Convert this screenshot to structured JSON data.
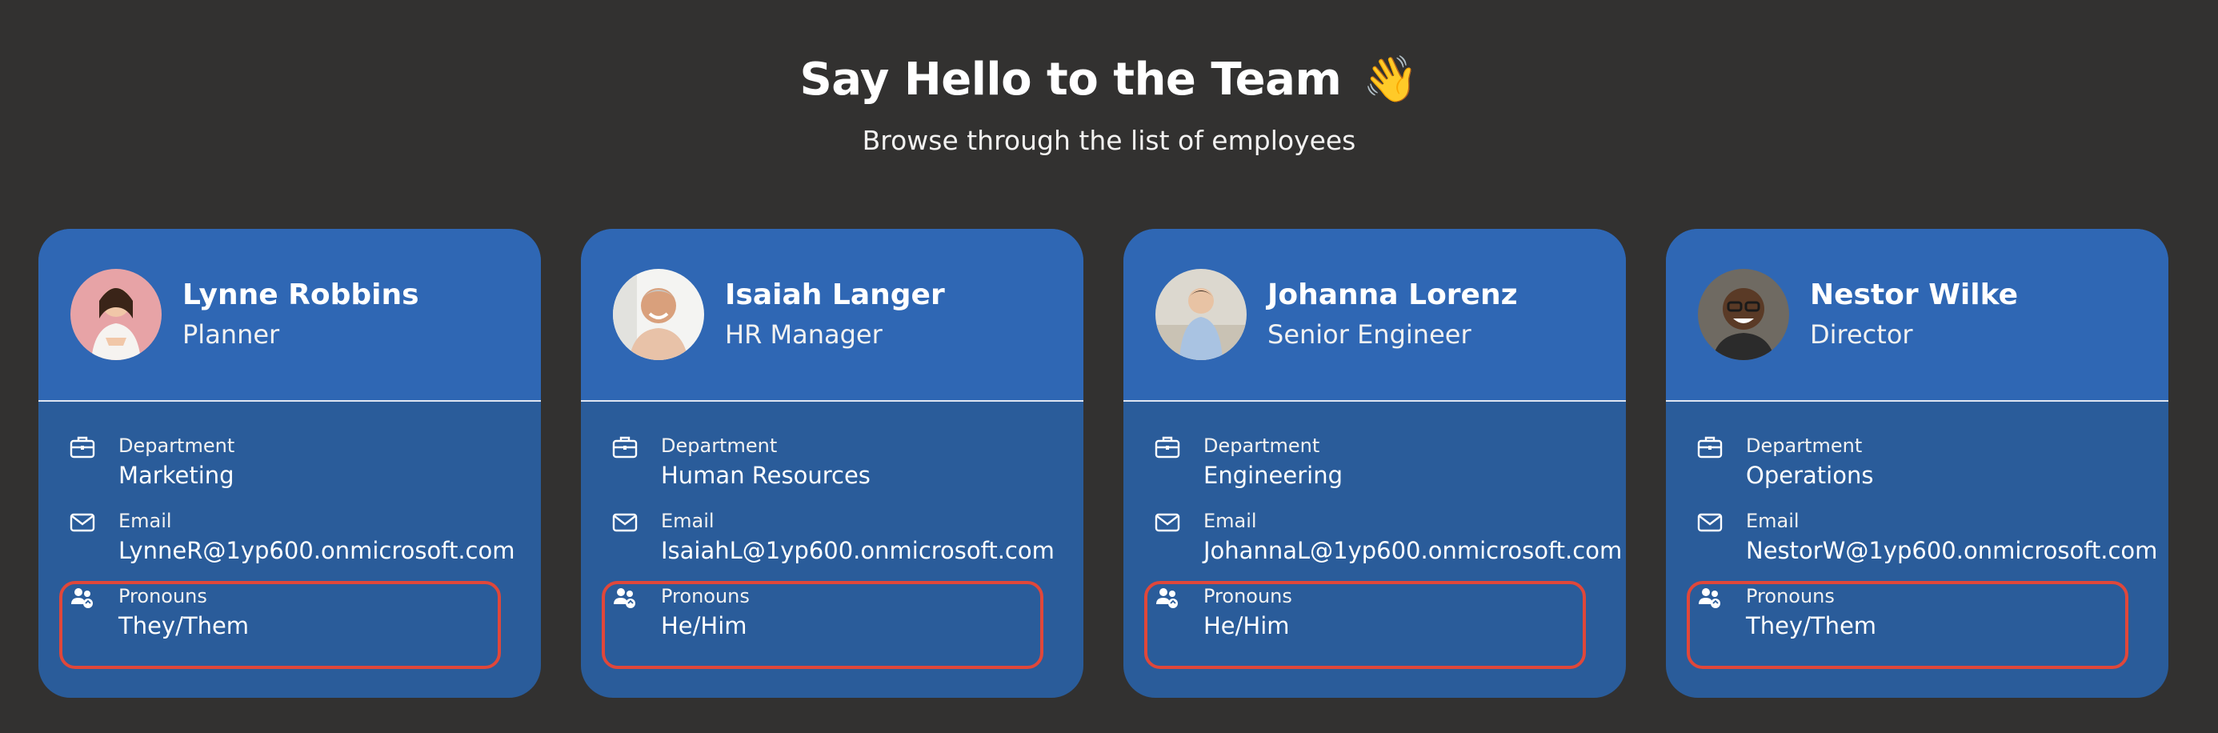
{
  "header": {
    "title": "Say Hello to the Team",
    "wave": "👋",
    "subtitle": "Browse through the list of employees"
  },
  "labels": {
    "department": "Department",
    "email": "Email",
    "pronouns": "Pronouns"
  },
  "icons": {
    "department": "briefcase-icon",
    "email": "mail-icon",
    "pronouns": "people-icon"
  },
  "colors": {
    "background": "#323130",
    "card_top": "#2f67b4",
    "card_body": "#2a5c9a",
    "highlight": "#e0473a"
  },
  "employees": [
    {
      "name": "Lynne Robbins",
      "title": "Planner",
      "department": "Marketing",
      "email": "LynneR@1yp600.onmicrosoft.com",
      "pronouns": "They/Them"
    },
    {
      "name": "Isaiah Langer",
      "title": "HR Manager",
      "department": "Human Resources",
      "email": "IsaiahL@1yp600.onmicrosoft.com",
      "pronouns": "He/Him"
    },
    {
      "name": "Johanna Lorenz",
      "title": "Senior Engineer",
      "department": "Engineering",
      "email": "JohannaL@1yp600.onmicrosoft.com",
      "pronouns": "He/Him"
    },
    {
      "name": "Nestor Wilke",
      "title": "Director",
      "department": "Operations",
      "email": "NestorW@1yp600.onmicrosoft.com",
      "pronouns": "They/Them"
    }
  ]
}
